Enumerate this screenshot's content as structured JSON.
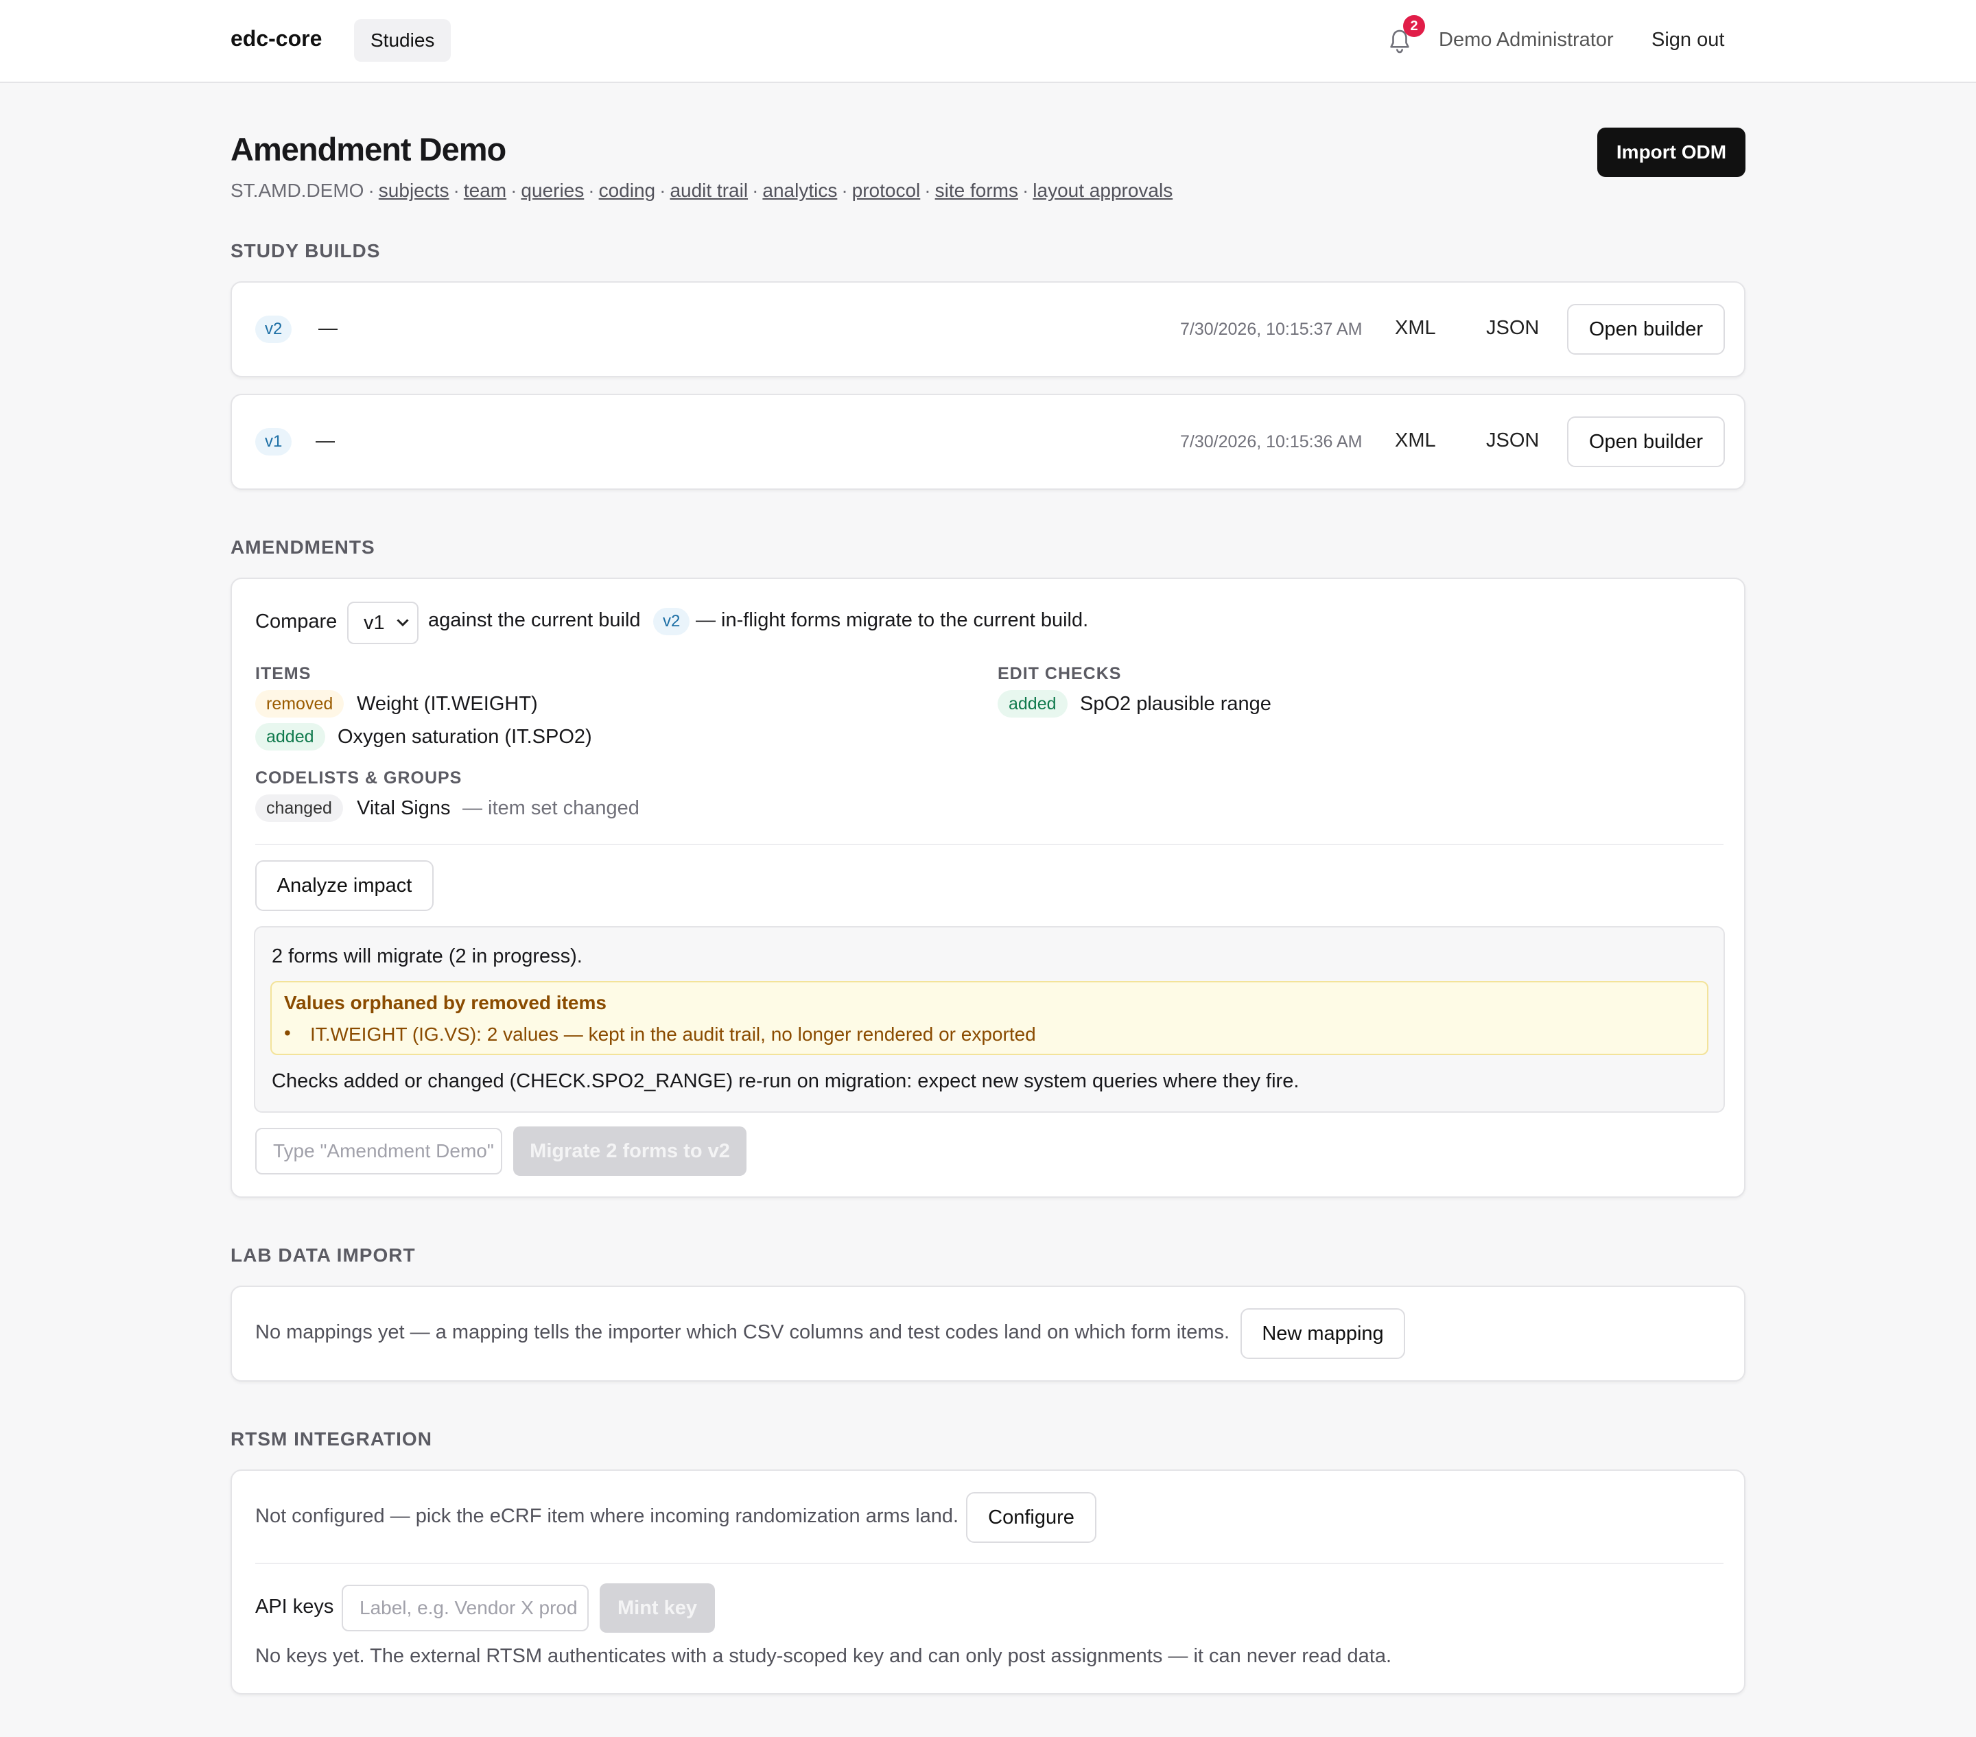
{
  "header": {
    "brand": "edc-core",
    "nav_studies": "Studies",
    "notifications_count": "2",
    "user_name": "Demo Administrator",
    "sign_out": "Sign out",
    "icon": "bell-icon"
  },
  "page": {
    "title": "Amendment Demo",
    "study_code": "ST.AMD.DEMO",
    "links": [
      "subjects",
      "team",
      "queries",
      "coding",
      "audit trail",
      "analytics",
      "protocol",
      "site forms",
      "layout approvals"
    ],
    "import_button": "Import ODM"
  },
  "study_builds": {
    "label": "STUDY BUILDS",
    "builds": [
      {
        "version": "v2",
        "desc": "—",
        "timestamp": "7/30/2026, 10:15:37 AM",
        "xml": "XML",
        "json": "JSON",
        "open": "Open builder"
      },
      {
        "version": "v1",
        "desc": "—",
        "timestamp": "7/30/2026, 10:15:36 AM",
        "xml": "XML",
        "json": "JSON",
        "open": "Open builder"
      }
    ]
  },
  "amendments": {
    "label": "AMENDMENTS",
    "compare_label": "Compare",
    "compare_selected": "v1",
    "against_text": "against the current build",
    "current_build": "v2",
    "migrate_note": "— in-flight forms migrate to the current build.",
    "items_heading": "ITEMS",
    "items": [
      {
        "tag": "removed",
        "text": "Weight (IT.WEIGHT)"
      },
      {
        "tag": "added",
        "text": "Oxygen saturation (IT.SPO2)"
      }
    ],
    "edit_checks_heading": "EDIT CHECKS",
    "edit_checks": [
      {
        "tag": "added",
        "text": "SpO2 plausible range"
      }
    ],
    "codelists_heading": "CODELISTS & GROUPS",
    "codelists": [
      {
        "tag": "changed",
        "text": "Vital Signs",
        "note": "— item set changed"
      }
    ],
    "analyze_button": "Analyze impact",
    "impact_summary": "2 forms will migrate (2 in progress).",
    "orphan_title": "Values orphaned by removed items",
    "orphan_item": "IT.WEIGHT (IG.VS): 2 values — kept in the audit trail, no longer rendered or exported",
    "checks_note": "Checks added or changed (CHECK.SPO2_RANGE) re-run on migration: expect new system queries where they fire.",
    "confirm_placeholder": "Type \"Amendment Demo\"",
    "migrate_button": "Migrate 2 forms to v2"
  },
  "lab_import": {
    "label": "LAB DATA IMPORT",
    "text": "No mappings yet — a mapping tells the importer which CSV columns and test codes land on which form items.",
    "button": "New mapping"
  },
  "rtsm": {
    "label": "RTSM INTEGRATION",
    "text": "Not configured — pick the eCRF item where incoming randomization arms land.",
    "configure_button": "Configure",
    "api_keys_label": "API keys",
    "key_placeholder": "Label, e.g. Vendor X prod",
    "mint_button": "Mint key",
    "no_keys_text": "No keys yet. The external RTSM authenticates with a study-scoped key and can only post assignments — it can never read data."
  }
}
